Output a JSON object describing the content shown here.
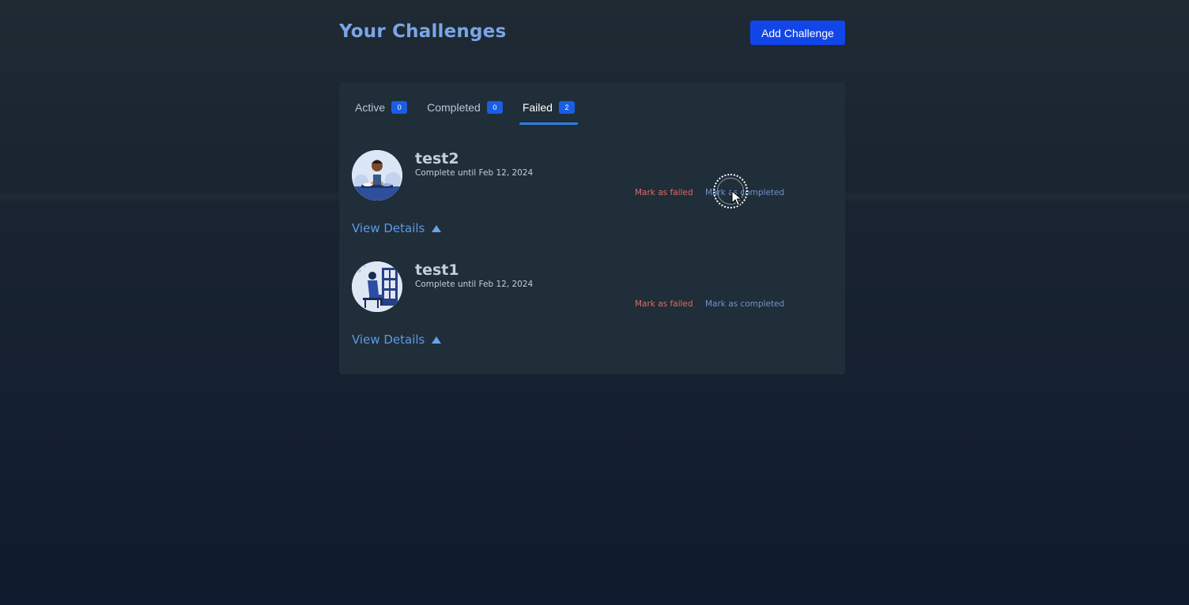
{
  "header": {
    "title": "Your Challenges",
    "add_button_label": "Add Challenge"
  },
  "tabs": [
    {
      "label": "Active",
      "count": "0",
      "active": false
    },
    {
      "label": "Completed",
      "count": "0",
      "active": false
    },
    {
      "label": "Failed",
      "count": "2",
      "active": true
    }
  ],
  "challenges": [
    {
      "name": "test2",
      "subtitle": "Complete until Feb 12, 2024",
      "avatar": "person-cooking-illustration",
      "fail_label": "Mark as failed",
      "complete_label": "Mark as completed",
      "details_label": "View Details"
    },
    {
      "name": "test1",
      "subtitle": "Complete until Feb 12, 2024",
      "avatar": "person-sitting-window-illustration",
      "fail_label": "Mark as failed",
      "complete_label": "Mark as completed",
      "details_label": "View Details"
    }
  ],
  "colors": {
    "accent": "#1245e8",
    "badge": "#1a5ee6",
    "title": "#7aa6e6",
    "danger": "#e06a62",
    "link": "#7391cf"
  }
}
